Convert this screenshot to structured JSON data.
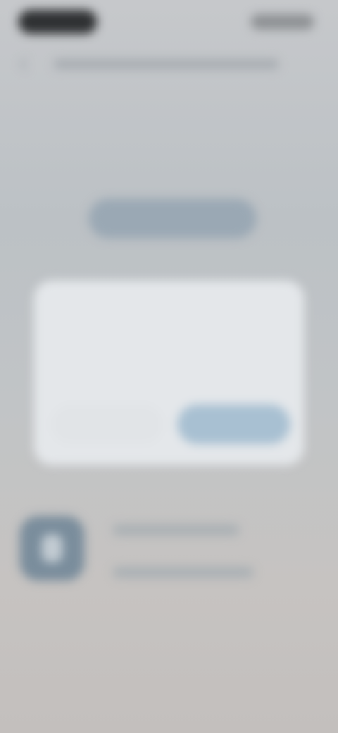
{
  "status_bar": {
    "time": "",
    "indicators": ""
  },
  "topbar": {
    "back_icon": "back-arrow-icon",
    "url": ""
  },
  "hero": {
    "button_label": ""
  },
  "dialog": {
    "title": "",
    "body": "",
    "secondary_label": "",
    "primary_label": ""
  },
  "app": {
    "icon": "app-icon",
    "line1": "",
    "line2": ""
  },
  "colors": {
    "primary_button": "#a8c0d2",
    "dialog_bg": "#e4e7ea",
    "app_icon_bg": "#7a8d9c"
  }
}
